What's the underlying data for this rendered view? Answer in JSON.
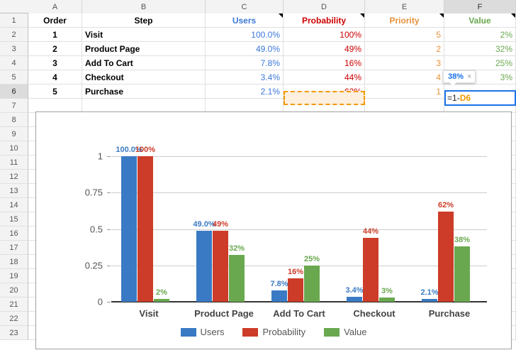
{
  "spreadsheet": {
    "column_headers": [
      "A",
      "B",
      "C",
      "D",
      "E",
      "F"
    ],
    "active_column": "F",
    "active_row": 6,
    "row_numbers": [
      1,
      2,
      3,
      4,
      5,
      6,
      7,
      8,
      9,
      10,
      11,
      12,
      13,
      14,
      15,
      16,
      17,
      18,
      19,
      20,
      21,
      22,
      23
    ],
    "header_row": {
      "A": "Order",
      "B": "Step",
      "C": "Users",
      "D": "Probability",
      "E": "Priority",
      "F": "Value"
    },
    "header_colors": {
      "A": "#000000",
      "B": "#000000",
      "C": "#3c78d8",
      "D": "#cc0000",
      "E": "#e69138",
      "F": "#6aa84f"
    },
    "rows": [
      {
        "row": 2,
        "order": "1",
        "step": "Visit",
        "users": "100.0%",
        "probability": "100%",
        "priority": "5",
        "value": "2%"
      },
      {
        "row": 3,
        "order": "2",
        "step": "Product Page",
        "users": "49.0%",
        "probability": "49%",
        "priority": "2",
        "value": "32%"
      },
      {
        "row": 4,
        "order": "3",
        "step": "Add To Cart",
        "users": "7.8%",
        "probability": "16%",
        "priority": "3",
        "value": "25%"
      },
      {
        "row": 5,
        "order": "4",
        "step": "Checkout",
        "users": "3.4%",
        "probability": "44%",
        "priority": "4",
        "value": "3%"
      },
      {
        "row": 6,
        "order": "5",
        "step": "Purchase",
        "users": "2.1%",
        "probability": "62%",
        "priority": "1",
        "value": ""
      }
    ],
    "formula_cell": {
      "address": "F6",
      "formula_prefix": "=1-",
      "formula_ref": "D6"
    },
    "dependency_cell": "D6",
    "tooltip": {
      "value": "38%",
      "close": "×"
    }
  },
  "chart_data": {
    "type": "bar",
    "title": "",
    "xlabel": "",
    "ylabel": "",
    "categories": [
      "Visit",
      "Product Page",
      "Add To Cart",
      "Checkout",
      "Purchase"
    ],
    "ylim": [
      0,
      1
    ],
    "yticks": [
      "0",
      "0.25",
      "0.5",
      "0.75",
      "1"
    ],
    "ytick_values": [
      0,
      0.25,
      0.5,
      0.75,
      1
    ],
    "grid": true,
    "legend_position": "bottom",
    "series": [
      {
        "name": "Users",
        "color": "#3a7ac4",
        "values": [
          1.0,
          0.49,
          0.078,
          0.034,
          0.021
        ],
        "labels": [
          "100.0%",
          "49.0%",
          "7.8%",
          "3.4%",
          "2.1%"
        ]
      },
      {
        "name": "Probability",
        "color": "#cc3c28",
        "values": [
          1.0,
          0.49,
          0.16,
          0.44,
          0.62
        ],
        "labels": [
          "100%",
          "49%",
          "16%",
          "44%",
          "62%"
        ]
      },
      {
        "name": "Value",
        "color": "#6aa84f",
        "values": [
          0.02,
          0.32,
          0.25,
          0.03,
          0.38
        ],
        "labels": [
          "2%",
          "32%",
          "25%",
          "3%",
          "38%"
        ]
      }
    ]
  }
}
